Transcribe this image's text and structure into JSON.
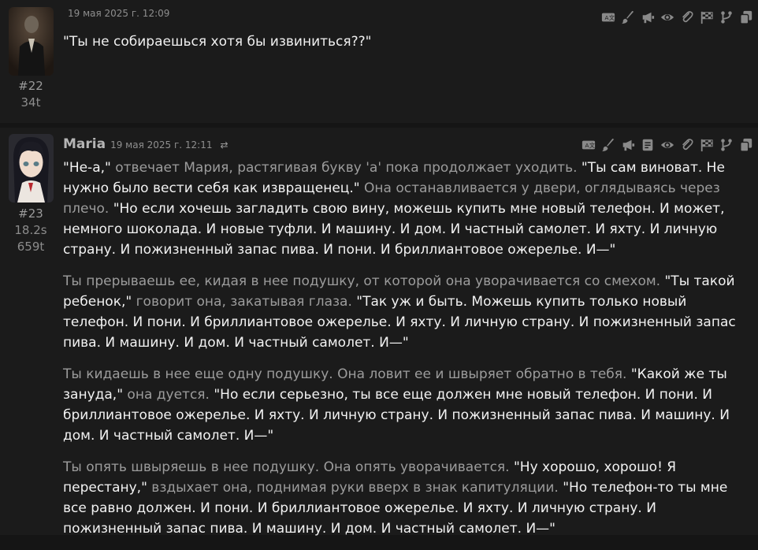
{
  "messages": [
    {
      "type": "user",
      "name": "",
      "date": "19 мая 2025 г. 12:09",
      "id": "#22",
      "time": "",
      "tokens": "34t",
      "text": "\"Ты не собираешься хотя бы извиниться??\""
    },
    {
      "type": "char",
      "name": "Maria",
      "date": "19 мая 2025 г. 12:11",
      "id": "#23",
      "time": "18.2s",
      "tokens": "659t",
      "paragraphs": [
        [
          {
            "s": "q",
            "t": "\"Не-а,\""
          },
          {
            "s": "n",
            "t": " отвечает Мария, растягивая букву 'а' пока продолжает уходить. "
          },
          {
            "s": "q",
            "t": "\"Ты сам виноват. Не нужно было вести себя как извращенец.\""
          },
          {
            "s": "n",
            "t": " Она останавливается у двери, оглядываясь через плечо. "
          },
          {
            "s": "q",
            "t": "\"Но если хочешь загладить свою вину, можешь купить мне новый телефон. И может, немного шоколада. И новые туфли. И машину. И дом. И частный самолет. И яхту. И личную страну. И пожизненный запас пива. И пони. И бриллиантовое ожерелье. И—\""
          }
        ],
        [
          {
            "s": "n",
            "t": "Ты прерываешь ее, кидая в нее подушку, от которой она уворачивается со смехом. "
          },
          {
            "s": "q",
            "t": "\"Ты такой ребенок,\""
          },
          {
            "s": "n",
            "t": " говорит она, закатывая глаза. "
          },
          {
            "s": "q",
            "t": "\"Так уж и быть. Можешь купить только новый телефон. И пони. И бриллиантовое ожерелье. И яхту. И личную страну. И пожизненный запас пива. И машину. И дом. И частный самолет. И—\""
          }
        ],
        [
          {
            "s": "n",
            "t": "Ты кидаешь в нее еще одну подушку. Она ловит ее и швыряет обратно в тебя. "
          },
          {
            "s": "q",
            "t": "\"Какой же ты зануда,\""
          },
          {
            "s": "n",
            "t": " она дуется. "
          },
          {
            "s": "q",
            "t": "\"Но если серьезно, ты все еще должен мне новый телефон. И пони. И бриллиантовое ожерелье. И яхту. И личную страну. И пожизненный запас пива. И машину. И дом. И частный самолет. И—\""
          }
        ],
        [
          {
            "s": "n",
            "t": "Ты опять швыряешь в нее подушку. Она опять уворачивается. "
          },
          {
            "s": "q",
            "t": "\"Ну хорошо, хорошо! Я перестану,\""
          },
          {
            "s": "n",
            "t": " вздыхает она, поднимая руки вверх в знак капитуляции. "
          },
          {
            "s": "q",
            "t": "\"Но телефон-то ты мне все равно должен. И пони. И бриллиантовое ожерелье. И яхту. И личную страну. И пожизненный запас пива. И машину. И дом. И частный самолет. И—\""
          }
        ]
      ]
    }
  ],
  "icons": {
    "user_toolbar": [
      "translate-icon",
      "paint-brush-icon",
      "megaphone-icon",
      "eye-icon",
      "paperclip-icon",
      "flag-checkered-icon",
      "code-branch-icon",
      "copy-icon"
    ],
    "char_toolbar": [
      "translate-icon",
      "paint-brush-icon",
      "megaphone-icon",
      "file-text-icon",
      "eye-icon",
      "paperclip-icon",
      "flag-checkered-icon",
      "code-branch-icon",
      "copy-icon"
    ]
  },
  "colors": {
    "background": "#151515",
    "message_bg": "#1b1b1b",
    "quote_text": "#f2f2f2",
    "narration_text": "#9c9c9c",
    "icon": "#8a8a8a"
  }
}
